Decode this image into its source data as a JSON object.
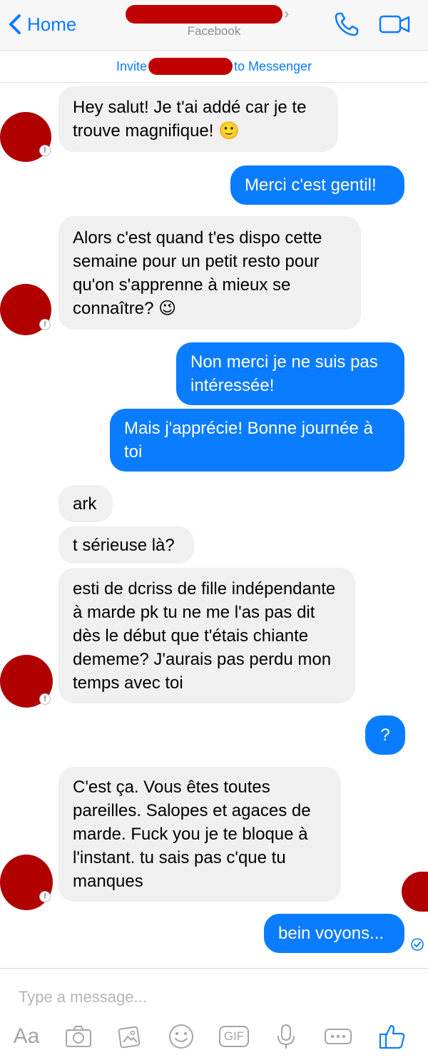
{
  "header": {
    "back_label": "Home",
    "subtitle": "Facebook"
  },
  "invite": {
    "prefix": "Invite",
    "suffix": "to Messenger"
  },
  "messages": [
    {
      "from": "them",
      "text": "Hey salut! Je t'ai addé car je te trouve magnifique! 🙂"
    },
    {
      "from": "me",
      "text": "Merci c'est gentil!"
    },
    {
      "from": "them",
      "text": "Alors c'est quand t'es dispo cette semaine pour un petit resto pour qu'on s'apprenne à mieux se connaître? 😉"
    },
    {
      "from": "me",
      "text": "Non merci je ne suis pas intéressée!"
    },
    {
      "from": "me",
      "text": "Mais j'apprécie! Bonne journée à toi"
    },
    {
      "from": "them",
      "text": "ark"
    },
    {
      "from": "them",
      "text": "t sérieuse là?"
    },
    {
      "from": "them",
      "text": "esti de dcriss de fille indépendante à marde pk tu ne me l'as pas dit dès le début que t'étais chiante dememe? J'aurais pas perdu mon temps avec toi"
    },
    {
      "from": "me",
      "text": "?"
    },
    {
      "from": "them",
      "text": "C'est ça. Vous êtes toutes pareilles. Salopes et agaces de marde. Fuck you je te bloque à l'instant. tu sais pas c'que tu manques"
    },
    {
      "from": "me",
      "text": "bein voyons..."
    }
  ],
  "composer": {
    "placeholder": "Type a message...",
    "tools": [
      "Aa",
      "camera-icon",
      "photo-icon",
      "emoji-icon",
      "GIF",
      "mic-icon",
      "more-icon",
      "like-icon"
    ]
  },
  "colors": {
    "accent": "#0a7cff",
    "incoming_bubble": "#f1f0f0",
    "redaction": "#c00000"
  }
}
